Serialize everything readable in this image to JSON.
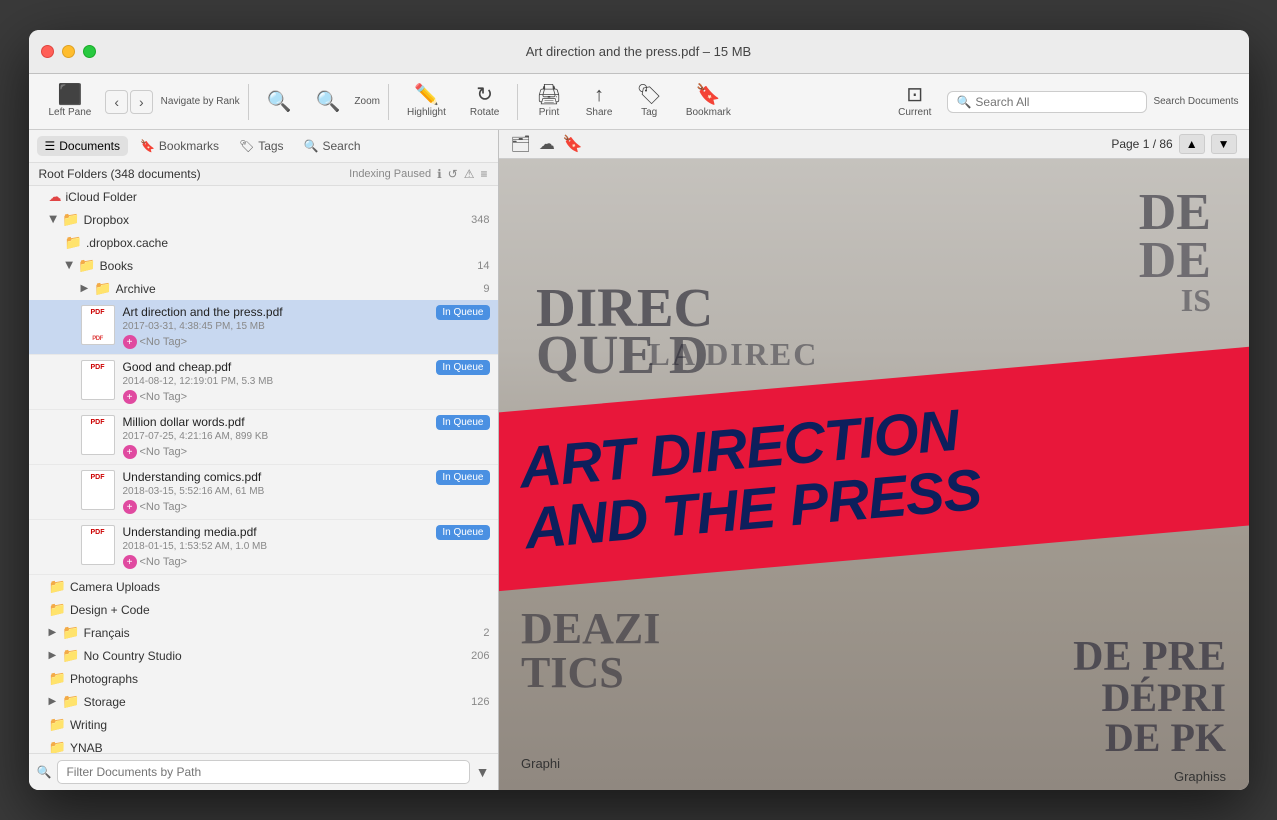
{
  "window": {
    "title": "Art direction and the press.pdf – 15 MB"
  },
  "titlebar": {
    "close_label": "×",
    "minimize_label": "–",
    "maximize_label": "+"
  },
  "toolbar": {
    "left_pane_label": "Left Pane",
    "back_label": "‹",
    "forward_label": "›",
    "navigate_label": "Navigate by Rank",
    "zoom_out_label": "−",
    "zoom_in_label": "+",
    "zoom_label": "Zoom",
    "highlight_label": "Highlight",
    "rotate_label": "Rotate",
    "print_label": "Print",
    "share_label": "Share",
    "tag_label": "Tag",
    "bookmark_label": "Bookmark",
    "current_label": "Current",
    "search_label": "Search Documents",
    "search_placeholder": "Search All"
  },
  "sidebar": {
    "tab_documents": "Documents",
    "tab_bookmarks": "Bookmarks",
    "tab_tags": "Tags",
    "tab_search": "Search",
    "root_label": "Root Folders (348 documents)",
    "indexing_label": "Indexing Paused",
    "folders": [
      {
        "name": "iCloud Folder",
        "icon": "icloud",
        "indent": 0,
        "count": null,
        "type": "icloud"
      },
      {
        "name": "Dropbox",
        "icon": "folder-blue",
        "indent": 0,
        "count": "348",
        "open": true
      },
      {
        "name": ".dropbox.cache",
        "icon": "folder-blue",
        "indent": 1,
        "count": null
      },
      {
        "name": "Books",
        "icon": "folder-blue",
        "indent": 1,
        "count": "14",
        "open": true
      },
      {
        "name": "Archive",
        "icon": "folder-blue",
        "indent": 2,
        "count": "9",
        "open": false
      }
    ],
    "pdf_items": [
      {
        "name": "Art direction and the press.pdf",
        "meta": "2017-03-31, 4:38:45 PM, 15 MB",
        "badge": "In Queue",
        "selected": true
      },
      {
        "name": "Good and cheap.pdf",
        "meta": "2014-08-12, 12:19:01 PM, 5.3 MB",
        "badge": "In Queue",
        "selected": false
      },
      {
        "name": "Million dollar words.pdf",
        "meta": "2017-07-25, 4:21:16 AM, 899 KB",
        "badge": "In Queue",
        "selected": false
      },
      {
        "name": "Understanding comics.pdf",
        "meta": "2018-03-15, 5:52:16 AM, 61 MB",
        "badge": "In Queue",
        "selected": false
      },
      {
        "name": "Understanding media.pdf",
        "meta": "2018-01-15, 1:53:52 AM, 1.0 MB",
        "badge": "In Queue",
        "selected": false
      }
    ],
    "more_folders": [
      {
        "name": "Camera Uploads",
        "icon": "folder-blue",
        "indent": 0,
        "count": null
      },
      {
        "name": "Design + Code",
        "icon": "folder-blue",
        "indent": 0,
        "count": null
      },
      {
        "name": "Français",
        "icon": "folder-blue",
        "indent": 0,
        "count": "2",
        "open": false
      },
      {
        "name": "No Country Studio",
        "icon": "folder-blue",
        "indent": 0,
        "count": "206",
        "open": false
      },
      {
        "name": "Photographs",
        "icon": "folder-blue",
        "indent": 0,
        "count": null
      },
      {
        "name": "Storage",
        "icon": "folder-blue",
        "indent": 0,
        "count": "126",
        "open": false
      },
      {
        "name": "Writing",
        "icon": "folder-blue",
        "indent": 0,
        "count": null
      },
      {
        "name": "YNAB",
        "icon": "folder-blue",
        "indent": 0,
        "count": null
      }
    ],
    "filter_placeholder": "Filter Documents by Path"
  },
  "viewer": {
    "page_label": "Page 1 / 86",
    "mag_title_line1": "ART DIRECTION",
    "mag_title_line2": "AND THE PRESS",
    "mag_text_left": "DIREC",
    "mag_text_top_right_1": "DE",
    "mag_text_top_right_2": "DE",
    "mag_bottom_right_1": "DE PRE",
    "mag_bottom_right_2": "DÉPRI",
    "mag_bottom_right_3": "DE PK",
    "mag_caption_bottom": "Graphi",
    "mag_caption_bottom2": "Graphiss"
  },
  "no_tag_label": "<No Tag>"
}
